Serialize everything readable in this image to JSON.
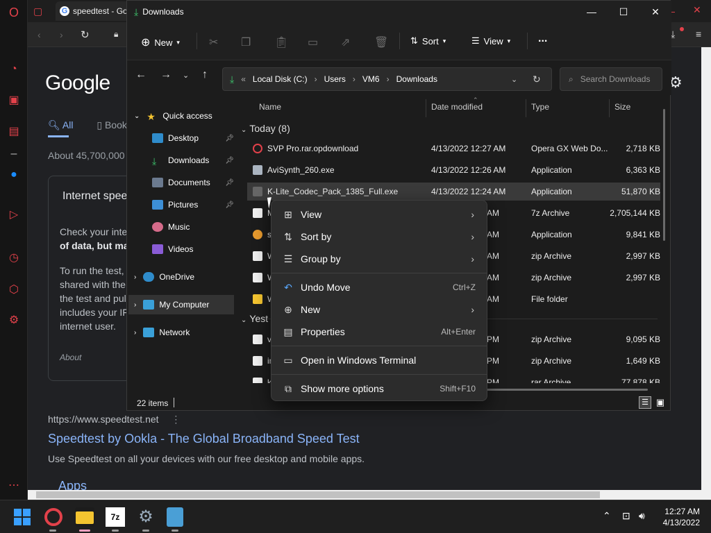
{
  "browser": {
    "tab_title": "speedtest - Go",
    "google": {
      "logo": "Google",
      "tab_all": "All",
      "tab_books": "Book",
      "about": "About 45,700,000",
      "card_title": "Internet spee",
      "card_line1": "Check your inte",
      "card_line2": "of data, but ma",
      "card_line3": "To run the test,",
      "card_line4": "shared with the",
      "card_line5": "the test and pul",
      "card_line6": "includes your IF",
      "card_line7": "internet user.",
      "card_about": "About",
      "result_url": "https://www.speedtest.net",
      "result_title": "Speedtest by Ookla - The Global Broadband Speed Test",
      "result_desc": "Use Speedtest on all your devices with our free desktop and mobile apps.",
      "apps": "Apps"
    }
  },
  "explorer": {
    "title": "Downloads",
    "toolbar": {
      "new": "New",
      "sort": "Sort",
      "view": "View",
      "more": "..."
    },
    "address": {
      "drive": "Local Disk (C:)",
      "users": "Users",
      "user": "VM6",
      "folder": "Downloads",
      "search_placeholder": "Search Downloads"
    },
    "nav": {
      "quick_access": "Quick access",
      "desktop": "Desktop",
      "downloads": "Downloads",
      "documents": "Documents",
      "pictures": "Pictures",
      "music": "Music",
      "videos": "Videos",
      "onedrive": "OneDrive",
      "my_computer": "My Computer",
      "network": "Network"
    },
    "columns": {
      "name": "Name",
      "date": "Date modified",
      "type": "Type",
      "size": "Size"
    },
    "groups": {
      "today": "Today (8)",
      "yesterday": "Yest"
    },
    "rows": [
      {
        "name": "SVP Pro.rar.opdownload",
        "date": "4/13/2022 12:27 AM",
        "type": "Opera GX Web Do...",
        "size": "2,718 KB"
      },
      {
        "name": "AviSynth_260.exe",
        "date": "4/13/2022 12:26 AM",
        "type": "Application",
        "size": "6,363 KB"
      },
      {
        "name": "K-Lite_Codec_Pack_1385_Full.exe",
        "date": "4/13/2022 12:24 AM",
        "type": "Application",
        "size": "51,870 KB"
      },
      {
        "name": "M",
        "date": "AM",
        "type": "7z Archive",
        "size": "2,705,144 KB"
      },
      {
        "name": "sv",
        "date": "AM",
        "type": "Application",
        "size": "9,841 KB"
      },
      {
        "name": "W",
        "date": "AM",
        "type": "zip Archive",
        "size": "2,997 KB"
      },
      {
        "name": "W",
        "date": "AM",
        "type": "zip Archive",
        "size": "2,997 KB"
      },
      {
        "name": "W",
        "date": "AM",
        "type": "File folder",
        "size": ""
      },
      {
        "name": "vY",
        "date": "PM",
        "type": "zip Archive",
        "size": "9,095 KB"
      },
      {
        "name": "in",
        "date": "PM",
        "type": "zip Archive",
        "size": "1,649 KB"
      },
      {
        "name": "ka",
        "date": "PM",
        "type": "rar Archive",
        "size": "77,878 KB"
      }
    ],
    "status": "22 items"
  },
  "context_menu": {
    "view": "View",
    "sort_by": "Sort by",
    "group_by": "Group by",
    "undo_move": "Undo Move",
    "undo_shortcut": "Ctrl+Z",
    "new": "New",
    "properties": "Properties",
    "properties_shortcut": "Alt+Enter",
    "terminal": "Open in Windows Terminal",
    "more_options": "Show more options",
    "more_shortcut": "Shift+F10"
  },
  "taskbar": {
    "time": "12:27 AM",
    "date": "4/13/2022"
  }
}
